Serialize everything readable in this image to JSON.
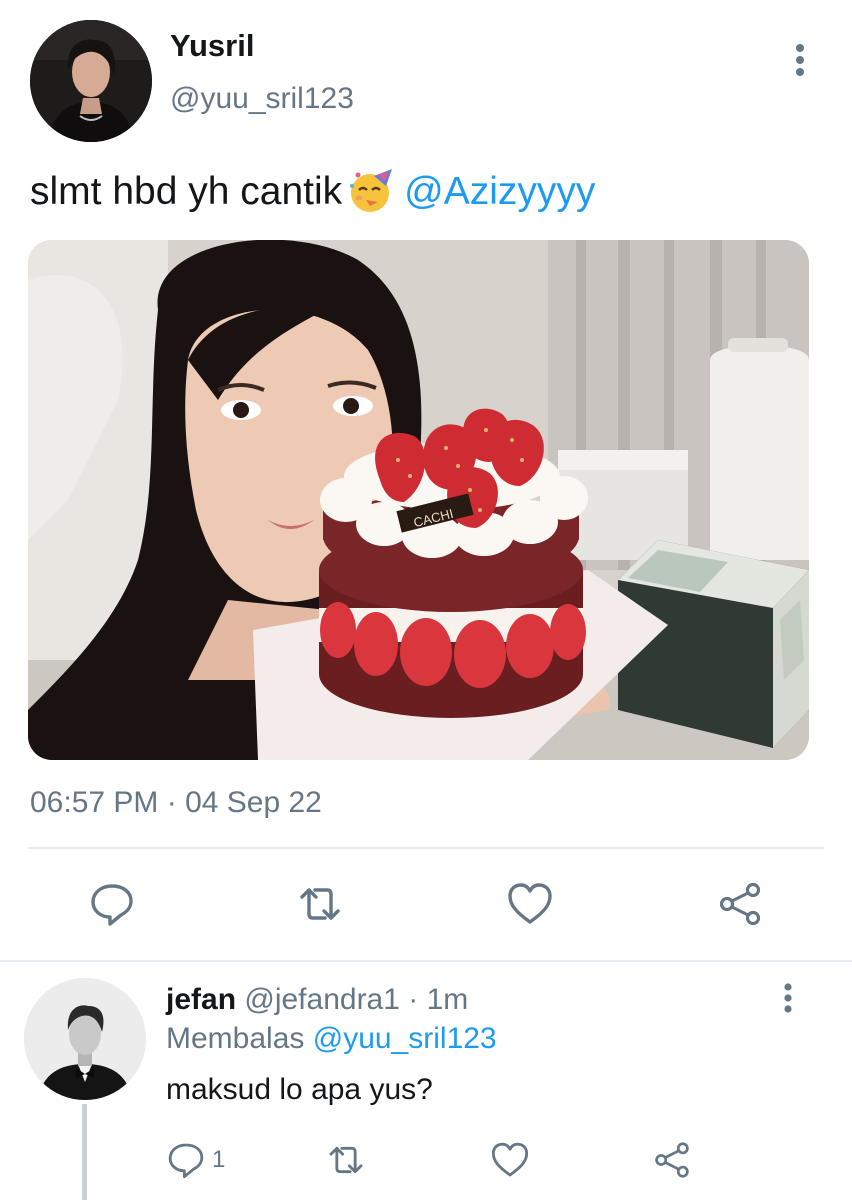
{
  "tweet": {
    "author_name": "Yusril",
    "author_handle": "@yuu_sril123",
    "text": "slmt hbd yh cantik",
    "emoji": "partying-face",
    "mention": "@Azizyyyy",
    "timestamp": "06:57 PM · 04 Sep 22",
    "photo": {
      "subject": "woman holding strawberry cake",
      "box_text": "CACHI",
      "cake_tag": "CACHI"
    }
  },
  "reply": {
    "author_name": "jefan",
    "author_handle": "@jefandra1",
    "time": "· 1m",
    "replying_label": "Membalas",
    "replying_handle": "@yuu_sril123",
    "text": "maksud lo apa yus?",
    "reply_count": "1"
  },
  "icons": {
    "more": "more-vertical-icon",
    "reply": "comment-icon",
    "retweet": "retweet-icon",
    "like": "heart-icon",
    "share": "share-icon"
  },
  "colors": {
    "accent": "#1d9bf0",
    "secondary_text": "#657786",
    "primary_text": "#14171a",
    "divider": "#e6ecf0"
  }
}
